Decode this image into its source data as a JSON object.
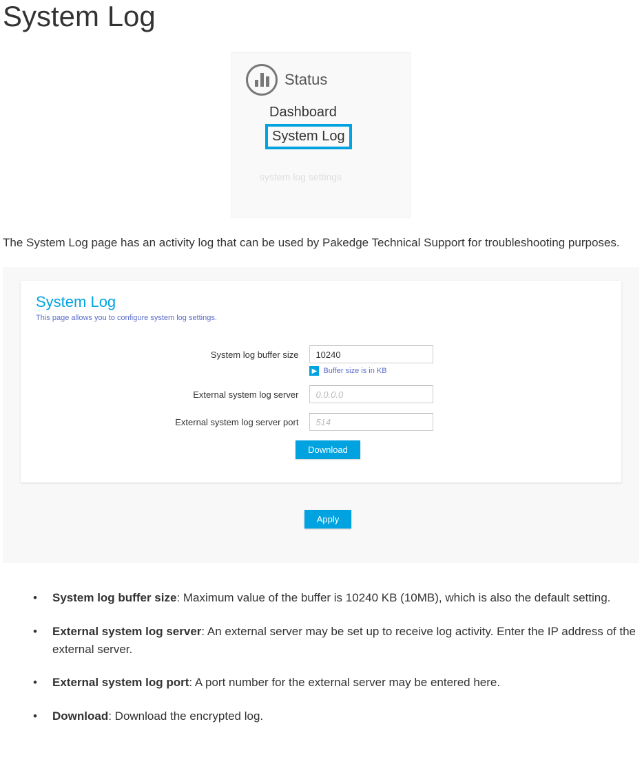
{
  "page": {
    "title": "System Log",
    "intro": "The System Log page has an activity log that can be used by Pakedge Technical Support for troubleshooting purposes."
  },
  "nav": {
    "status_label": "Status",
    "item_dashboard": "Dashboard",
    "item_system_log": "System Log",
    "faded": "system log settings"
  },
  "panel": {
    "title": "System Log",
    "subtitle": "This page allows you to configure system log settings.",
    "buffer_label": "System log buffer size",
    "buffer_value": "10240",
    "buffer_hint": "Buffer size is in KB",
    "server_label": "External system log server",
    "server_placeholder": "0.0.0.0",
    "port_label": "External system log server port",
    "port_placeholder": "514",
    "download_label": "Download",
    "apply_label": "Apply"
  },
  "bullets": {
    "b1_title": "System log buffer size",
    "b1_text": ": Maximum value of the buffer is 10240 KB (10MB), which is also the default setting.",
    "b2_title": "External system log server",
    "b2_text": ": An external server may be set up to receive log activity. Enter the IP address of the external server.",
    "b3_title": "External system log port",
    "b3_text": ": A port number for the external server may be entered here.",
    "b4_title": "Download",
    "b4_text": ": Download the encrypted log."
  }
}
